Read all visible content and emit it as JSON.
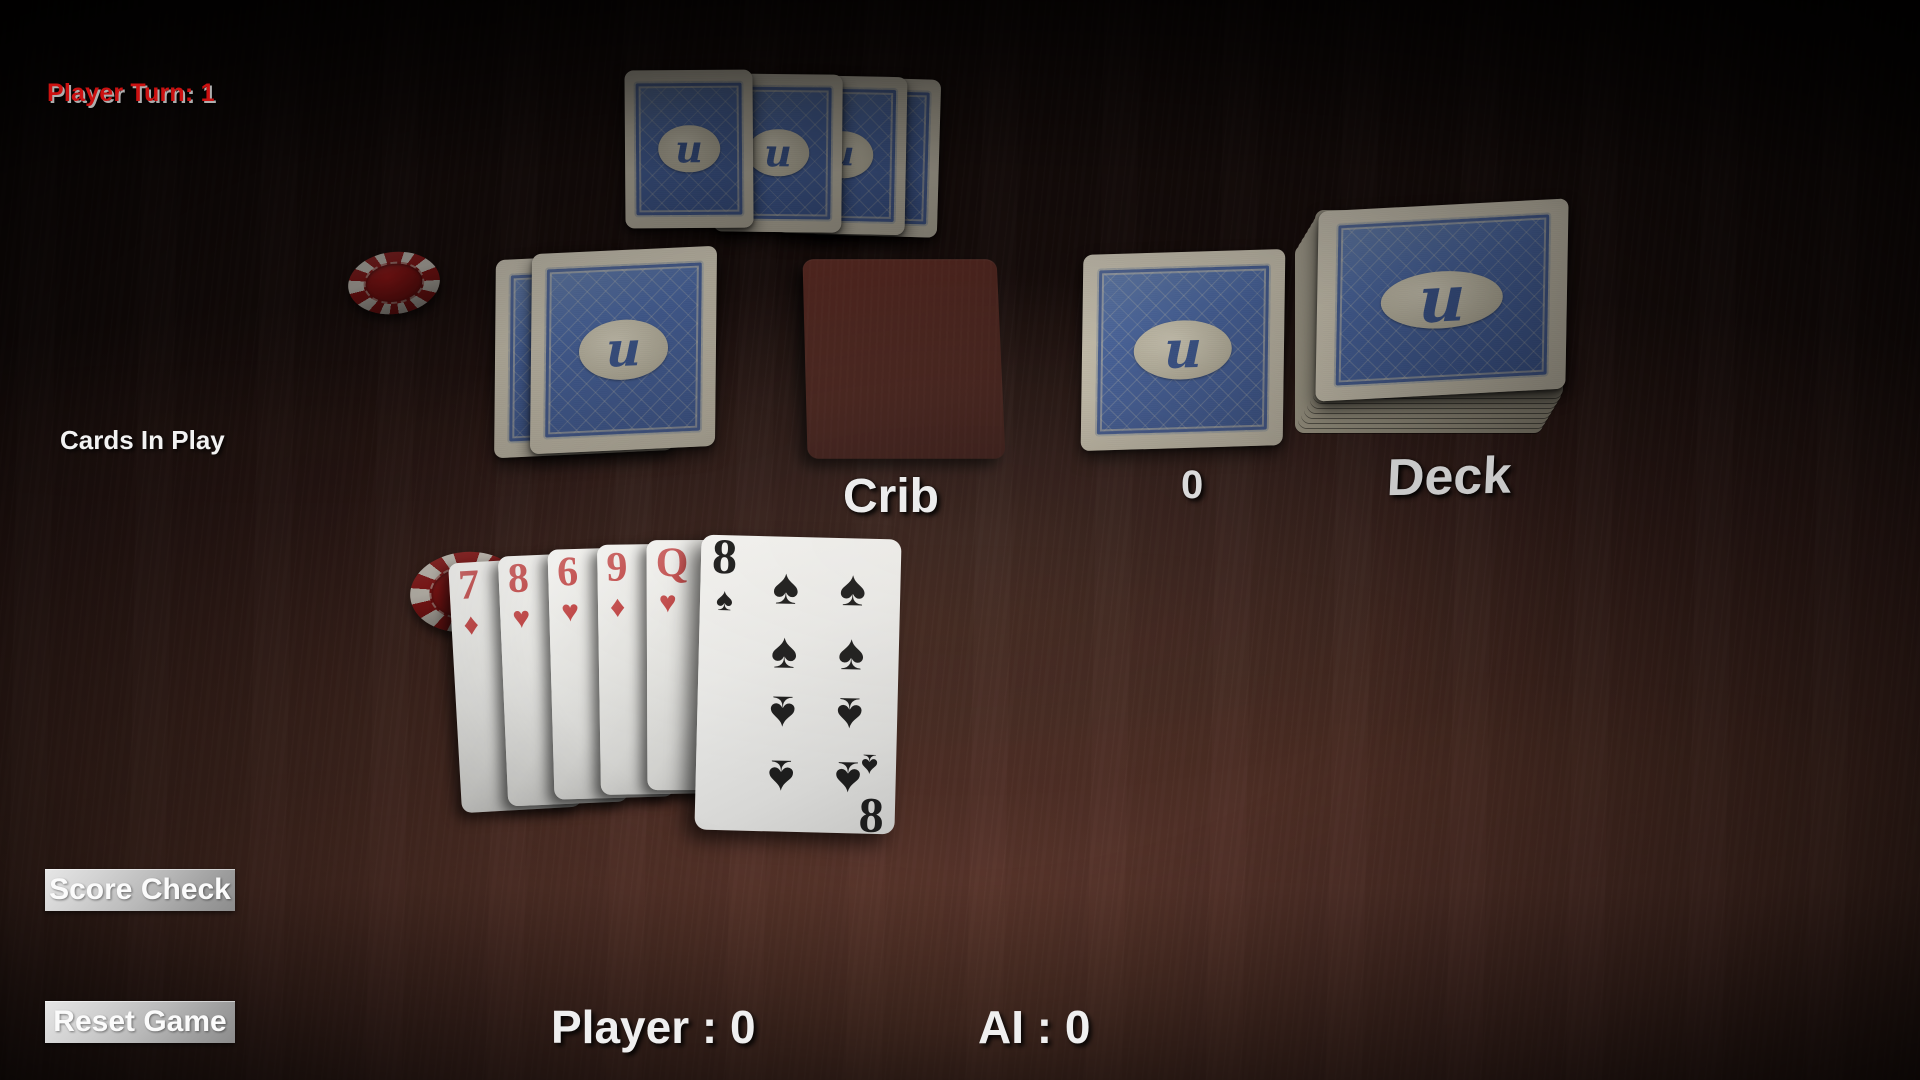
{
  "hud": {
    "player_turn": "Player Turn: 1",
    "cards_in_play_label": "Cards In Play",
    "crib_label": "Crib",
    "cards_in_play_count": "0",
    "deck_label": "Deck",
    "score_player": "Player :  0",
    "score_ai": "AI :  0"
  },
  "buttons": {
    "score_check": "Score Check",
    "reset_game": "Reset Game"
  },
  "colors": {
    "turn_text": "#cc1111",
    "hud_text": "#efefef",
    "table": "#41271f",
    "card_back_blue": "#4a66a0",
    "card_back_cream": "#c9c2b0",
    "crib_slot": "#4e2720",
    "chip_red": "#7d1414",
    "chip_white": "#b9b4ab",
    "red_suit": "#b93434",
    "black_suit": "#1d1d1d"
  },
  "card_back": {
    "logo": "u",
    "logo_name": "unreal-u-logo"
  },
  "ai_hand": {
    "count": 4,
    "cards": [
      {
        "face_up": false,
        "name": "ai-card-1"
      },
      {
        "face_up": false,
        "name": "ai-card-2"
      },
      {
        "face_up": false,
        "name": "ai-card-3"
      },
      {
        "face_up": false,
        "name": "ai-card-4"
      }
    ]
  },
  "cards_in_play": {
    "count": 2,
    "cards": [
      {
        "face_up": false,
        "name": "play-card-1"
      },
      {
        "face_up": false,
        "name": "play-card-2"
      }
    ]
  },
  "crib": {
    "count": 0,
    "empty": true
  },
  "counter_card": {
    "face_up": false
  },
  "deck": {
    "face_up": false,
    "stacked": true
  },
  "chips": [
    {
      "name": "chip-upper",
      "color": "red-white"
    },
    {
      "name": "chip-lower",
      "color": "red-white"
    }
  ],
  "player_hand": {
    "cards": [
      {
        "rank": "7",
        "suit": "♦",
        "suit_name": "diamonds",
        "color": "red",
        "selected": false
      },
      {
        "rank": "8",
        "suit": "♥",
        "suit_name": "hearts",
        "color": "red",
        "selected": false
      },
      {
        "rank": "6",
        "suit": "♥",
        "suit_name": "hearts",
        "color": "red",
        "selected": false
      },
      {
        "rank": "9",
        "suit": "♦",
        "suit_name": "diamonds",
        "color": "red",
        "selected": false
      },
      {
        "rank": "Q",
        "suit": "♥",
        "suit_name": "hearts",
        "color": "red",
        "selected": false
      },
      {
        "rank": "8",
        "suit": "♠",
        "suit_name": "spades",
        "color": "black",
        "selected": true
      }
    ]
  }
}
